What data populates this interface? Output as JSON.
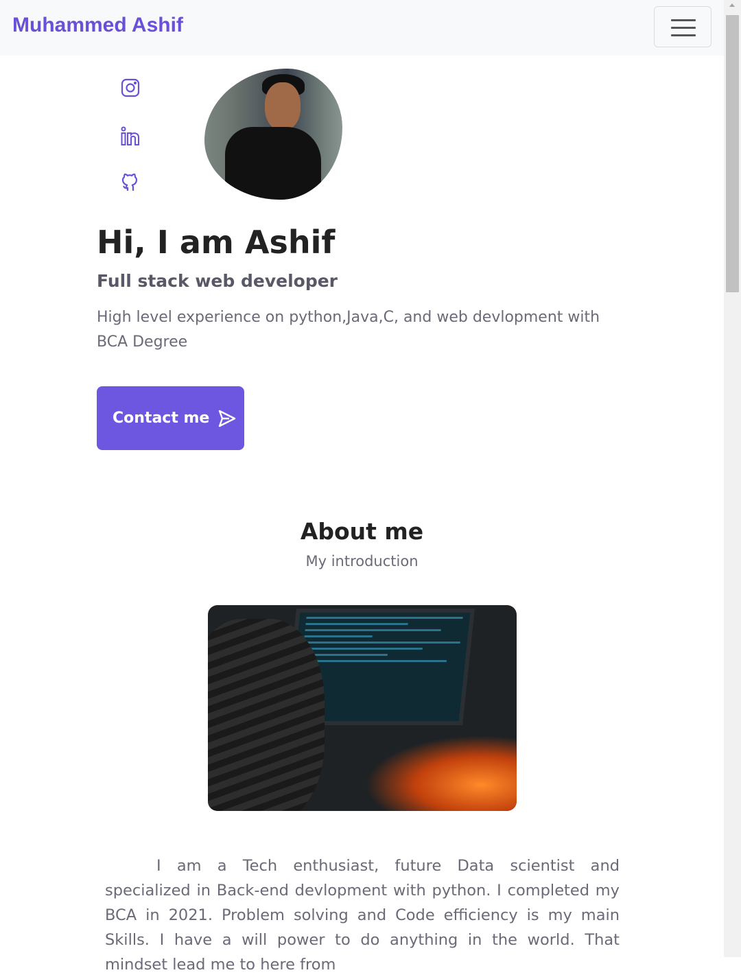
{
  "navbar": {
    "brand": "Muhammed Ashif",
    "menu_icon": "hamburger-icon"
  },
  "social": [
    {
      "icon": "instagram-icon"
    },
    {
      "icon": "linkedin-icon"
    },
    {
      "icon": "github-icon"
    }
  ],
  "hero": {
    "title": "Hi, I am Ashif",
    "subtitle": "Full stack web developer",
    "description": "High level experience on python,Java,C, and web devlopment with BCA Degree",
    "contact_label": "Contact me",
    "contact_icon": "send-icon"
  },
  "about": {
    "title": "About me",
    "subtitle": "My introduction",
    "text": "I am a Tech enthusiast, future Data scientist and specialized in Back-end devlopment with python. I completed my BCA in 2021. Problem solving and Code efficiency is my main Skills. I have a will power to do anything in the world. That mindset lead me to here from"
  },
  "colors": {
    "accent": "#6e57e0",
    "brand": "#6a4fd8"
  }
}
